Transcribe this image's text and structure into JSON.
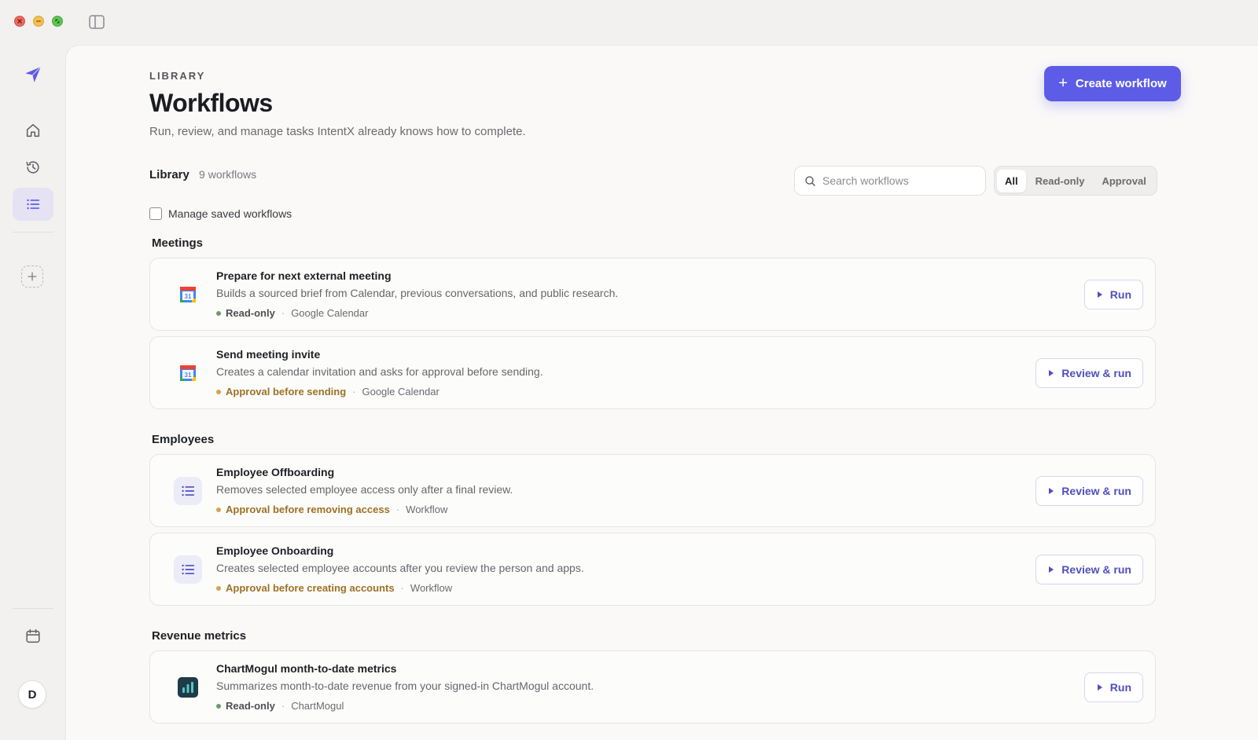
{
  "header": {
    "eyebrow": "LIBRARY",
    "title": "Workflows",
    "subtitle": "Run, review, and manage tasks IntentX already knows how to complete.",
    "create_label": "Create workflow",
    "create_icon": "plus-icon"
  },
  "sidebar": {
    "items": [
      {
        "name": "logo",
        "icon": "paper-plane-icon"
      },
      {
        "name": "home",
        "icon": "home-icon"
      },
      {
        "name": "history",
        "icon": "history-icon"
      },
      {
        "name": "workflows",
        "icon": "list-icon",
        "active": true
      },
      {
        "name": "add",
        "icon": "plus-icon"
      },
      {
        "name": "calendar",
        "icon": "calendar-icon"
      }
    ],
    "avatar_initial": "D"
  },
  "library": {
    "label": "Library",
    "count": "9 workflows",
    "search_placeholder": "Search workflows",
    "filters": [
      "All",
      "Read-only",
      "Approval"
    ],
    "active_filter": "All",
    "manage_label": "Manage saved workflows"
  },
  "sections": [
    {
      "title": "Meetings",
      "cards": [
        {
          "title": "Prepare for next external meeting",
          "desc": "Builds a sourced brief from Calendar, previous conversations, and public research.",
          "status": "Read-only",
          "source": "Google Calendar",
          "button": "Run",
          "icon": "google-calendar-icon"
        },
        {
          "title": "Send meeting invite",
          "desc": "Creates a calendar invitation and asks for approval before sending.",
          "status": "Approval before sending",
          "source": "Google Calendar",
          "button": "Review & run",
          "icon": "google-calendar-icon"
        }
      ]
    },
    {
      "title": "Employees",
      "cards": [
        {
          "title": "Employee Offboarding",
          "desc": "Removes selected employee access only after a final review.",
          "status": "Approval before removing access",
          "source": "Workflow",
          "button": "Review & run",
          "icon": "list-icon"
        },
        {
          "title": "Employee Onboarding",
          "desc": "Creates selected employee accounts after you review the person and apps.",
          "status": "Approval before creating accounts",
          "source": "Workflow",
          "button": "Review & run",
          "icon": "list-icon"
        }
      ]
    },
    {
      "title": "Revenue metrics",
      "cards": [
        {
          "title": "ChartMogul month-to-date metrics",
          "desc": "Summarizes month-to-date revenue from your signed-in ChartMogul account.",
          "status": "Read-only",
          "source": "ChartMogul",
          "button": "Run",
          "icon": "chartmogul-icon"
        }
      ]
    }
  ],
  "colors": {
    "accent": "#5c5ce6",
    "readonly_dot": "#6f9a6f",
    "approval_dot": "#d6a352",
    "approval_text": "#9d7125"
  }
}
